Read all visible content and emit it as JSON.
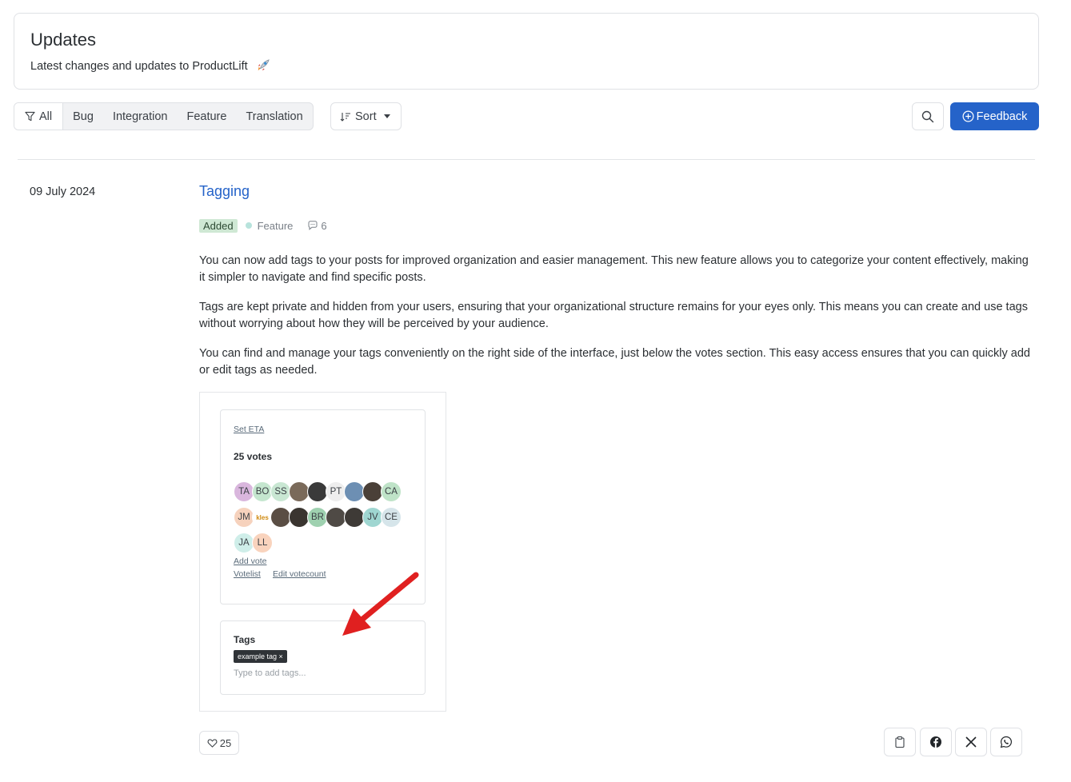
{
  "header": {
    "title": "Updates",
    "subtitle": "Latest changes and updates to ProductLift"
  },
  "filters": {
    "items": [
      "All",
      "Bug",
      "Integration",
      "Feature",
      "Translation"
    ],
    "active": "All"
  },
  "sort": {
    "label": "Sort"
  },
  "feedback_button": {
    "label": "Feedback"
  },
  "post": {
    "date": "09 July 2024",
    "title": "Tagging",
    "status": "Added",
    "category": "Feature",
    "comments": "6",
    "paragraphs": [
      "You can now add tags to your posts for improved organization and easier management. This new feature allows you to categorize your content effectively, making it simpler to navigate and find specific posts.",
      "Tags are kept private and hidden from your users, ensuring that your organizational structure remains for your eyes only. This means you can create and use tags without worrying about how they will be perceived by your audience.",
      "You can find and manage your tags conveniently on the right side of the interface, just below the votes section. This easy access ensures that you can quickly add or edit tags as needed."
    ],
    "likes": "25"
  },
  "screenshot": {
    "set_eta": "Set ETA",
    "votes": "25 votes",
    "avatar_rows": [
      [
        "TA",
        "BO",
        "SS",
        "",
        "",
        "PT",
        "",
        "",
        "CA"
      ],
      [
        "JM",
        "kles",
        "",
        "",
        "BR",
        "",
        "",
        "JV",
        "CE"
      ],
      [
        "JA",
        "LL"
      ]
    ],
    "avatar_colors": [
      [
        "#d9b6dd",
        "#c5e6cf",
        "#c9e7d3",
        "#7a6a5a",
        "#3a3a3a",
        "#eeeeee",
        "#6d8fb3",
        "#4a4038",
        "#bfe3c8"
      ],
      [
        "#f6d2bd",
        "#ffffff",
        "#5a4e44",
        "#3a3530",
        "#9fd1b0",
        "#4f4a45",
        "#3e3a36",
        "#9fd6d1",
        "#d6e5ea"
      ],
      [
        "#cfeee9",
        "#f9d3bd"
      ]
    ],
    "add_vote": "Add vote",
    "votelist": "Votelist",
    "edit_votecount": "Edit votecount",
    "tags_title": "Tags",
    "tag_example": "example tag ×",
    "tag_placeholder": "Type to add tags..."
  },
  "icons": {
    "filter": "filter-icon",
    "sort": "sort-icon",
    "search": "search-icon",
    "feedback": "plus-circle-icon",
    "comment": "comment-icon",
    "like": "heart-icon",
    "share": [
      "clipboard-icon",
      "facebook-icon",
      "x-icon",
      "whatsapp-icon"
    ]
  },
  "colors": {
    "accent": "#2563c9",
    "added_badge": "#cfe8d4",
    "feature_dot": "#b8e3dc"
  }
}
